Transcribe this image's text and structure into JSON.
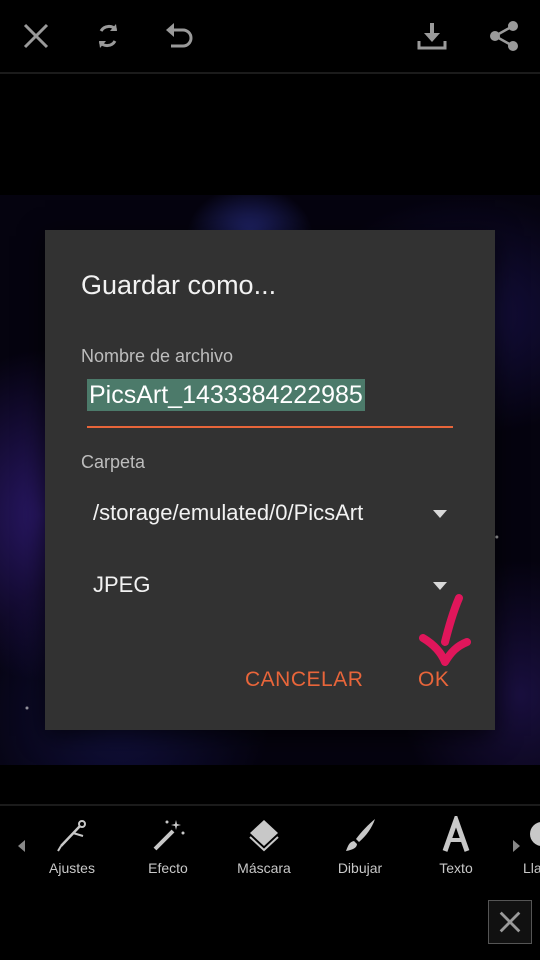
{
  "toolbar": {
    "close_icon": "close-icon",
    "rotate_icon": "refresh-icon",
    "undo_icon": "undo-icon",
    "download_icon": "download-icon",
    "share_icon": "share-icon"
  },
  "dialog": {
    "title": "Guardar como...",
    "filename_label": "Nombre de archivo",
    "filename_value": "PicsArt_1433384222985",
    "folder_label": "Carpeta",
    "folder_value": "/storage/emulated/0/PicsArt",
    "format_value": "JPEG",
    "cancel_label": "CANCELAR",
    "ok_label": "OK",
    "accent_color": "#e8653a"
  },
  "tools": {
    "items": [
      {
        "label": "Ajustes",
        "icon": "compass-icon"
      },
      {
        "label": "Efecto",
        "icon": "magic-wand-icon"
      },
      {
        "label": "Máscara",
        "icon": "layers-icon"
      },
      {
        "label": "Dibujar",
        "icon": "brush-icon"
      },
      {
        "label": "Texto",
        "icon": "text-icon"
      },
      {
        "label": "Lla",
        "icon": "sticker-icon"
      }
    ]
  }
}
